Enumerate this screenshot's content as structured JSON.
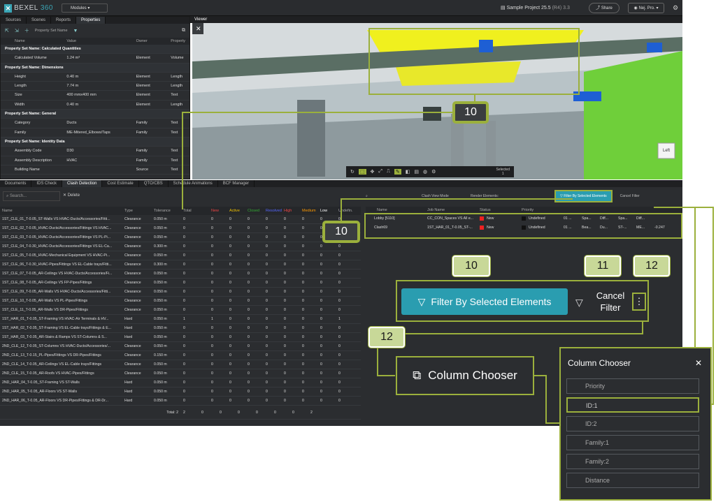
{
  "app": {
    "logo": "BEXEL",
    "logo_suffix": "360",
    "modules": "Modules",
    "project": "Sample Project 25.5",
    "version": "(R4) 3.3",
    "share": "Share",
    "user": "Nej. Pro."
  },
  "left_panel": {
    "tabs": [
      "Sources",
      "Scenes",
      "Reports",
      "Properties"
    ],
    "property_set_placeholder": "Property Set Name",
    "columns": [
      "Name",
      "Value",
      "Owner",
      "Property"
    ],
    "rows": [
      {
        "g": true,
        "name": "Property Set Name: Calculated Quantities"
      },
      {
        "name": "Calculated Volume",
        "value": "1.24 m³",
        "owner": "Element",
        "prop": "Volume"
      },
      {
        "g": true,
        "name": "Property Set Name: Dimensions"
      },
      {
        "name": "Height",
        "value": "0.40 m",
        "owner": "Element",
        "prop": "Length"
      },
      {
        "name": "Length",
        "value": "7.74 m",
        "owner": "Element",
        "prop": "Length"
      },
      {
        "name": "Size",
        "value": "400 mmx400 mm",
        "owner": "Element",
        "prop": "Text"
      },
      {
        "name": "Width",
        "value": "0.40 m",
        "owner": "Element",
        "prop": "Length"
      },
      {
        "g": true,
        "name": "Property Set Name: General"
      },
      {
        "name": "Category",
        "value": "Ducts",
        "owner": "Family",
        "prop": "Text"
      },
      {
        "name": "Family",
        "value": "ME-Mitered_Elbows/Taps",
        "owner": "Family",
        "prop": "Text"
      },
      {
        "g": true,
        "name": "Property Set Name: Identity Data"
      },
      {
        "name": "Assembly Code",
        "value": "D30",
        "owner": "Family",
        "prop": "Text"
      },
      {
        "name": "Assembly Description",
        "value": "HVAC",
        "owner": "Family",
        "prop": "Text"
      },
      {
        "name": "Building Name",
        "value": "",
        "owner": "Source",
        "prop": "Text"
      }
    ]
  },
  "viewer": {
    "tab": "Viewer",
    "selected_label": "Selected",
    "selected_count": "1",
    "cube": "Left",
    "colors": {
      "sky": "#c9d1d4",
      "floor": "#7d8a8f",
      "yellow": "#f0f01e",
      "green": "#6fcf3a",
      "blue": "#1e5fd4"
    }
  },
  "bottom_tabs": [
    "Documents",
    "IDS Check",
    "Clash Detection",
    "Cost Estimate",
    "QTO/CBS",
    "Schedule Animations",
    "BCF Manager"
  ],
  "clash": {
    "search_placeholder": "Search...",
    "delete": "Delete",
    "columns": [
      "Name",
      "Type",
      "Tolerance",
      "Total",
      "New",
      "Active",
      "Closed",
      "Resolved",
      "High",
      "Medium",
      "Low",
      "Undefin."
    ],
    "rows": [
      [
        "1ST_CLE_01_T-0.05_ST-Walls VS HVAC-Ducts/Accessories/Fitti...",
        "Clearance",
        "0.050 m",
        "0",
        "0",
        "0",
        "0",
        "0",
        "0",
        "0",
        "0",
        "0"
      ],
      [
        "1ST_CLE_02_T-0.05_HVAC-Ducts/Accessories/Fittings VS HVAC...",
        "Clearance",
        "0.050 m",
        "0",
        "0",
        "0",
        "0",
        "0",
        "0",
        "0",
        "0",
        "0"
      ],
      [
        "1ST_CLE_03_T-0.05_HVAC-Ducts/Accessories/Fittings VS PL-Pi...",
        "Clearance",
        "0.050 m",
        "0",
        "0",
        "0",
        "0",
        "0",
        "0",
        "0",
        "0",
        "0"
      ],
      [
        "1ST_CLE_04_T-0.30_HVAC-Ducts/Accessories/Fittings VS EL-Ca...",
        "Clearance",
        "0.300 m",
        "0",
        "0",
        "0",
        "0",
        "0",
        "0",
        "0",
        "0",
        "0"
      ],
      [
        "1ST_CLE_05_T-0.05_HVAC-Mechanical Equipment VS HVAC-Pi...",
        "Clearance",
        "0.050 m",
        "0",
        "0",
        "0",
        "0",
        "0",
        "0",
        "0",
        "0",
        "0"
      ],
      [
        "1ST_CLE_06_T-0.30_HVAC-Pipes/Fittings VS EL-Cable trays/Fitti...",
        "Clearance",
        "0.300 m",
        "0",
        "0",
        "0",
        "0",
        "0",
        "0",
        "0",
        "0",
        "0"
      ],
      [
        "1ST_CLE_07_T-0.05_AR-Ceilings VS HVAC-Ducts/Accessories/Fi...",
        "Clearance",
        "0.050 m",
        "0",
        "0",
        "0",
        "0",
        "0",
        "0",
        "0",
        "0",
        "0"
      ],
      [
        "1ST_CLE_08_T-0.05_AR-Ceilings VS FP-Pipes/Fittings",
        "Clearance",
        "0.050 m",
        "0",
        "0",
        "0",
        "0",
        "0",
        "0",
        "0",
        "0",
        "0"
      ],
      [
        "1ST_CLE_09_T-0.05_AR-Walls VS HVAC-Ducts/Accessories/Fitti...",
        "Clearance",
        "0.050 m",
        "0",
        "0",
        "0",
        "0",
        "0",
        "0",
        "0",
        "0",
        "0"
      ],
      [
        "1ST_CLE_10_T-0.05_AR-Walls VS PL-Pipes/Fittings",
        "Clearance",
        "0.050 m",
        "0",
        "0",
        "0",
        "0",
        "0",
        "0",
        "0",
        "0",
        "0"
      ],
      [
        "1ST_CLE_11_T-0.05_AR-Walls VS DR-Pipes/Fittings",
        "Clearance",
        "0.050 m",
        "0",
        "0",
        "0",
        "0",
        "0",
        "0",
        "0",
        "0",
        "0"
      ],
      [
        "1ST_HAR_01_T-0.05_ST-Framing VS HVAC-Air Terminals & HV...",
        "Hard",
        "0.050 m",
        "1",
        "1",
        "0",
        "0",
        "0",
        "0",
        "0",
        "0",
        "1"
      ],
      [
        "1ST_HAR_02_T-0.05_ST-Framing VS EL-Cable trays/Fittings & E...",
        "Hard",
        "0.050 m",
        "0",
        "0",
        "0",
        "0",
        "0",
        "0",
        "0",
        "0",
        "0"
      ],
      [
        "1ST_HAR_03_T-0.05_AR-Stairs & Ramps VS ST-Columns & S...",
        "Hard",
        "0.050 m",
        "0",
        "0",
        "0",
        "0",
        "0",
        "0",
        "0",
        "0",
        "0"
      ],
      [
        "2ND_CLE_12_T-0.05_ST-Columns VS HVAC-Ducts/Accessories/...",
        "Clearance",
        "0.050 m",
        "0",
        "0",
        "0",
        "0",
        "0",
        "0",
        "0",
        "0",
        "0"
      ],
      [
        "2ND_CLE_13_T-0.15_PL-Pipes/Fittings VS DR-Pipes/Fittings",
        "Clearance",
        "0.150 m",
        "0",
        "0",
        "0",
        "0",
        "0",
        "0",
        "0",
        "0",
        "0"
      ],
      [
        "2ND_CLE_14_T-0.05_AR-Ceilings VS EL-Cable trays/Fittings",
        "Clearance",
        "0.050 m",
        "0",
        "0",
        "0",
        "0",
        "0",
        "0",
        "0",
        "0",
        "0"
      ],
      [
        "2ND_CLE_15_T-0.05_AR-Roofs VS HVAC-Pipes/Fittings",
        "Clearance",
        "0.050 m",
        "0",
        "0",
        "0",
        "0",
        "0",
        "0",
        "0",
        "0",
        "0"
      ],
      [
        "2ND_HAR_04_T-0.05_ST-Framing VS ST-Walls",
        "Hard",
        "0.050 m",
        "0",
        "0",
        "0",
        "0",
        "0",
        "0",
        "0",
        "0",
        "0"
      ],
      [
        "2ND_HAR_05_T-0.05_AR-Floors VS ST-Walls",
        "Hard",
        "0.050 m",
        "0",
        "0",
        "0",
        "0",
        "0",
        "0",
        "0",
        "0",
        "0"
      ],
      [
        "2ND_HAR_06_T-0.05_AR-Floors VS DR-Pipes/Fittings & DR-Dr...",
        "Hard",
        "0.050 m",
        "0",
        "0",
        "0",
        "0",
        "0",
        "0",
        "0",
        "0",
        "0"
      ]
    ],
    "total_label": "Total: 2",
    "totals": [
      "2",
      "0",
      "0",
      "0",
      "0",
      "0",
      "0",
      "2"
    ],
    "right_toolbar": {
      "clash_view_mode": "Clash View Mode",
      "render_elements": "Render Elements:",
      "filter_btn": "Filter By Selected Elements",
      "cancel_filter": "Cancel Filter"
    },
    "right_columns": [
      "Name",
      "Job Name",
      "Status",
      "Priority"
    ],
    "right_rows": [
      [
        "Lobby [5110]",
        "CC_CON_Spaces VS All e...",
        "New",
        "Undefined",
        "01 ...",
        "Spa...",
        "Diff...",
        "Spa...",
        "Diff...",
        ""
      ],
      [
        "Clash69",
        "1ST_HAR_01_T-0.05_ST-...",
        "New",
        "Undefined",
        "01 ...",
        "Bea...",
        "Du...",
        "ST-...",
        "ME...",
        "-0.247"
      ]
    ]
  },
  "callouts": {
    "a": "10",
    "b": "10",
    "c": "10",
    "d": "11",
    "e": "12",
    "f": "12"
  },
  "zoom": {
    "filter": "Filter By Selected Elements",
    "cancel": "Cancel Filter",
    "column_chooser": "Column Chooser"
  },
  "chooser": {
    "title": "Column Chooser",
    "items": [
      "Priority",
      "ID:1",
      "ID:2",
      "Family:1",
      "Family:2",
      "Distance"
    ]
  }
}
